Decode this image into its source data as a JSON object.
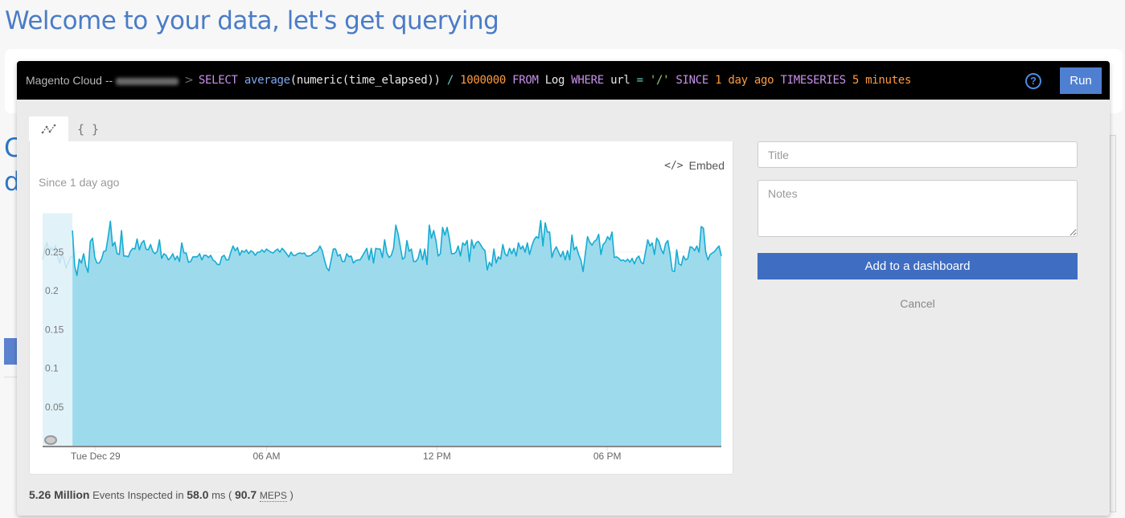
{
  "page": {
    "title": "Welcome to your data, let's get querying",
    "background_heading_fragments": [
      "C",
      "d"
    ]
  },
  "query_bar": {
    "account_label": "Magento Cloud --",
    "account_name_redacted": true,
    "breadcrumb_separator": ">",
    "tokens": [
      {
        "text": "SELECT ",
        "kind": "kw"
      },
      {
        "text": "average",
        "kind": "fn"
      },
      {
        "text": "(numeric(time_elapsed)) ",
        "kind": "plain"
      },
      {
        "text": "/ ",
        "kind": "op"
      },
      {
        "text": "1000000 ",
        "kind": "num"
      },
      {
        "text": "FROM ",
        "kind": "kw"
      },
      {
        "text": "Log ",
        "kind": "plain"
      },
      {
        "text": "WHERE ",
        "kind": "kw"
      },
      {
        "text": "url ",
        "kind": "plain"
      },
      {
        "text": "= ",
        "kind": "op"
      },
      {
        "text": "'/' ",
        "kind": "str"
      },
      {
        "text": "SINCE ",
        "kind": "kw"
      },
      {
        "text": "1 day ago ",
        "kind": "num"
      },
      {
        "text": "TIMESERIES ",
        "kind": "kw"
      },
      {
        "text": "5 minutes",
        "kind": "num"
      }
    ],
    "help_icon": "?",
    "run_label": "Run"
  },
  "tabs": [
    {
      "name": "chart",
      "icon": "line-chart-icon",
      "glyph": "⩘",
      "active": true
    },
    {
      "name": "json",
      "icon": "json-braces-icon",
      "glyph": "{ }",
      "active": false
    }
  ],
  "chart_panel": {
    "since_label": "Since 1 day ago",
    "embed_label": "Embed",
    "embed_icon": "</>"
  },
  "stats": {
    "events": "5.26 Million",
    "events_text": "Events Inspected in",
    "duration": "58.0",
    "duration_unit": "ms (",
    "meps": "90.7",
    "meps_label": "MEPS",
    "close": ")"
  },
  "form": {
    "title_placeholder": "Title",
    "title_value": "",
    "notes_placeholder": "Notes",
    "notes_value": "",
    "add_label": "Add to a dashboard",
    "cancel_label": "Cancel"
  },
  "colors": {
    "accent": "#4a7cc7",
    "run_button": "#4f7fd0",
    "add_button": "#3f6dc2",
    "series_line": "#16acd3",
    "series_fill": "#9ddbec",
    "previous_fill": "#e2f2f9"
  },
  "chart_data": {
    "type": "area",
    "title": "",
    "since": "Since 1 day ago",
    "xlabel": "",
    "ylabel": "",
    "ylim": [
      0,
      0.29
    ],
    "y_ticks": [
      0.05,
      0.1,
      0.15,
      0.2,
      0.25
    ],
    "y_tick_labels": [
      "0.05",
      "0.1",
      "0.15",
      "0.2",
      "0.25"
    ],
    "x_ticks": [
      {
        "label": "Tue Dec 29",
        "pos": 0.078
      },
      {
        "label": "06 AM",
        "pos": 0.33
      },
      {
        "label": "12 PM",
        "pos": 0.581
      },
      {
        "label": "06 PM",
        "pos": 0.832
      }
    ],
    "x_unit": "5-minute buckets over 1 day",
    "previous_period_fraction": 0.044,
    "grid": true,
    "legend": "none",
    "series": [
      {
        "name": "average(numeric(time_elapsed)) / 1000000",
        "values": [
          0.278,
          0.232,
          0.22,
          0.241,
          0.236,
          0.248,
          0.232,
          0.224,
          0.264,
          0.268,
          0.243,
          0.236,
          0.236,
          0.241,
          0.251,
          0.252,
          0.27,
          0.29,
          0.258,
          0.263,
          0.248,
          0.247,
          0.278,
          0.245,
          0.245,
          0.244,
          0.251,
          0.255,
          0.254,
          0.267,
          0.253,
          0.262,
          0.265,
          0.254,
          0.253,
          0.26,
          0.251,
          0.248,
          0.251,
          0.266,
          0.242,
          0.248,
          0.246,
          0.24,
          0.243,
          0.248,
          0.24,
          0.245,
          0.238,
          0.262,
          0.249,
          0.249,
          0.237,
          0.238,
          0.244,
          0.244,
          0.244,
          0.248,
          0.24,
          0.246,
          0.246,
          0.243,
          0.246,
          0.24,
          0.238,
          0.234,
          0.234,
          0.244,
          0.246,
          0.24,
          0.24,
          0.25,
          0.258,
          0.252,
          0.256,
          0.246,
          0.252,
          0.25,
          0.253,
          0.248,
          0.252,
          0.25,
          0.246,
          0.25,
          0.25,
          0.253,
          0.25,
          0.254,
          0.252,
          0.25,
          0.249,
          0.252,
          0.254,
          0.25,
          0.255,
          0.252,
          0.248,
          0.244,
          0.25,
          0.246,
          0.246,
          0.248,
          0.249,
          0.248,
          0.249,
          0.245,
          0.245,
          0.246,
          0.249,
          0.25,
          0.252,
          0.258,
          0.252,
          0.24,
          0.23,
          0.226,
          0.24,
          0.254,
          0.254,
          0.245,
          0.247,
          0.238,
          0.238,
          0.248,
          0.244,
          0.245,
          0.236,
          0.239,
          0.24,
          0.24,
          0.245,
          0.25,
          0.255,
          0.24,
          0.255,
          0.236,
          0.255,
          0.254,
          0.254,
          0.243,
          0.266,
          0.249,
          0.243,
          0.246,
          0.255,
          0.285,
          0.274,
          0.258,
          0.241,
          0.243,
          0.265,
          0.251,
          0.254,
          0.238,
          0.238,
          0.242,
          0.254,
          0.24,
          0.254,
          0.234,
          0.285,
          0.268,
          0.278,
          0.265,
          0.245,
          0.248,
          0.282,
          0.272,
          0.282,
          0.268,
          0.248,
          0.248,
          0.25,
          0.258,
          0.245,
          0.262,
          0.259,
          0.265,
          0.238,
          0.266,
          0.255,
          0.262,
          0.264,
          0.26,
          0.255,
          0.252,
          0.227,
          0.237,
          0.232,
          0.254,
          0.236,
          0.244,
          0.241,
          0.26,
          0.248,
          0.245,
          0.255,
          0.248,
          0.255,
          0.245,
          0.262,
          0.254,
          0.258,
          0.25,
          0.262,
          0.247,
          0.258,
          0.266,
          0.27,
          0.268,
          0.291,
          0.258,
          0.288,
          0.276,
          0.276,
          0.243,
          0.252,
          0.257,
          0.25,
          0.244,
          0.251,
          0.24,
          0.252,
          0.24,
          0.272,
          0.253,
          0.257,
          0.247,
          0.24,
          0.225,
          0.248,
          0.27,
          0.263,
          0.259,
          0.264,
          0.266,
          0.273,
          0.247,
          0.26,
          0.263,
          0.27,
          0.266,
          0.276,
          0.243,
          0.244,
          0.242,
          0.239,
          0.24,
          0.238,
          0.241,
          0.237,
          0.242,
          0.235,
          0.242,
          0.245,
          0.237,
          0.235,
          0.25,
          0.266,
          0.258,
          0.262,
          0.247,
          0.268,
          0.264,
          0.254,
          0.248,
          0.261,
          0.265,
          0.248,
          0.226,
          0.225,
          0.253,
          0.235,
          0.233,
          0.245,
          0.24,
          0.242,
          0.257,
          0.256,
          0.252,
          0.258,
          0.25,
          0.283,
          0.281,
          0.25,
          0.24,
          0.247,
          0.249,
          0.251,
          0.255,
          0.258,
          0.245
        ],
        "previous_values": [
          0.24,
          0.255,
          0.262,
          0.25,
          0.256,
          0.252,
          0.258,
          0.245,
          0.236,
          0.247,
          0.241,
          0.23,
          0.236,
          0.243,
          0.245
        ]
      }
    ]
  }
}
